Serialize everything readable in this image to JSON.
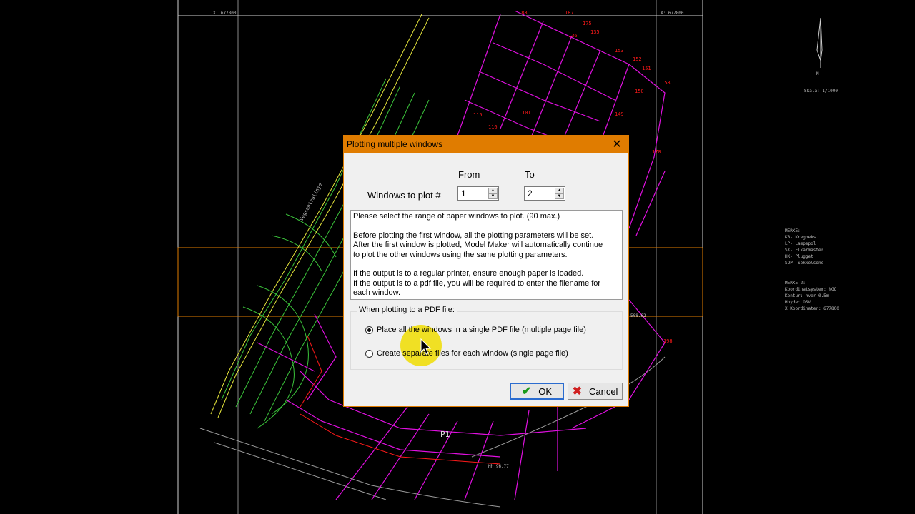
{
  "cad": {
    "labels_red": [
      "188",
      "187",
      "175",
      "136",
      "135",
      "153",
      "152",
      "151",
      "158",
      "150",
      "149",
      "170",
      "115",
      "101",
      "116",
      "198",
      "P1"
    ],
    "coord_top_left": "X: 677800",
    "coord_top_right": "X: 677800",
    "north_label": "N",
    "scale_label": "Skala: 1/1000",
    "legend_title": "MERKE:",
    "legend_items": [
      "KB- Kregbeks",
      "LP- Lampepol",
      "SK- Elkarmaster",
      "HK- Plugget",
      "SOP- Sokkelsone"
    ],
    "notes_title": "MERKE 2:",
    "notes_items": [
      "Koordinatsystem: NGO",
      "Kontur: hver 0.5m",
      "Hoyde: OSV",
      "X Koordinater: 677800"
    ],
    "road_label": "Vegsentralinje",
    "height_label": "Hh 96.77",
    "side_coord": "508.62"
  },
  "dialog": {
    "title": "Plotting multiple windows",
    "close_symbol": "✕",
    "from_label": "From",
    "to_label": "To",
    "windows_label": "Windows to plot #",
    "from_value": "1",
    "to_value": "2",
    "info_paragraphs": [
      "Please select the range of paper windows to plot. (90 max.)",
      "Before plotting the first window, all the plotting parameters will be set.\nAfter the first window is plotted, Model Maker will automatically continue\nto plot the other windows using the same plotting parameters.",
      "If the output is to a regular printer, ensure enough paper is loaded.\nIf the output is to a pdf file, you will be required to enter the filename for\neach window."
    ],
    "pdf_group_title": "When plotting to a PDF file:",
    "option_single": "Place all the windows in a single PDF file (multiple page file)",
    "option_separate": "Create separate files for each window (single page file)",
    "selected_option": "single",
    "ok_label": "OK",
    "cancel_label": "Cancel"
  },
  "colors": {
    "titlebar": "#e07c00",
    "magenta": "#e010e0",
    "red_labels": "#ff1a1a",
    "orange_frame": "#e07c00"
  }
}
